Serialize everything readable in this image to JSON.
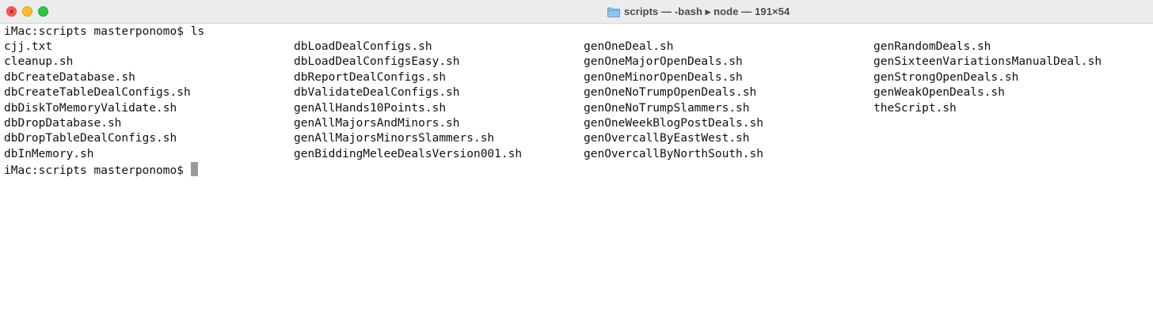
{
  "window": {
    "title": "scripts — -bash ▸ node — 191×54",
    "icon": "folder-icon"
  },
  "terminal": {
    "command_line": {
      "prompt": "iMac:scripts masterponomo$",
      "command": "ls"
    },
    "columns": [
      [
        "cjj.txt",
        "cleanup.sh",
        "dbCreateDatabase.sh",
        "dbCreateTableDealConfigs.sh",
        "dbDiskToMemoryValidate.sh",
        "dbDropDatabase.sh",
        "dbDropTableDealConfigs.sh",
        "dbInMemory.sh"
      ],
      [
        "dbLoadDealConfigs.sh",
        "dbLoadDealConfigsEasy.sh",
        "dbReportDealConfigs.sh",
        "dbValidateDealConfigs.sh",
        "genAllHands10Points.sh",
        "genAllMajorsAndMinors.sh",
        "genAllMajorsMinorsSlammers.sh",
        "genBiddingMeleeDealsVersion001.sh"
      ],
      [
        "genOneDeal.sh",
        "genOneMajorOpenDeals.sh",
        "genOneMinorOpenDeals.sh",
        "genOneNoTrumpOpenDeals.sh",
        "genOneNoTrumpSlammers.sh",
        "genOneWeekBlogPostDeals.sh",
        "genOvercallByEastWest.sh",
        "genOvercallByNorthSouth.sh"
      ],
      [
        "genRandomDeals.sh",
        "genSixteenVariationsManualDeal.sh",
        "genStrongOpenDeals.sh",
        "genWeakOpenDeals.sh",
        "theScript.sh"
      ]
    ],
    "final_prompt": "iMac:scripts masterponomo$"
  },
  "colors": {
    "close": "#ff5f57",
    "minimize": "#febc2e",
    "maximize": "#28c840",
    "titlebar": "#ececec",
    "cursor": "#9a9a9a"
  }
}
